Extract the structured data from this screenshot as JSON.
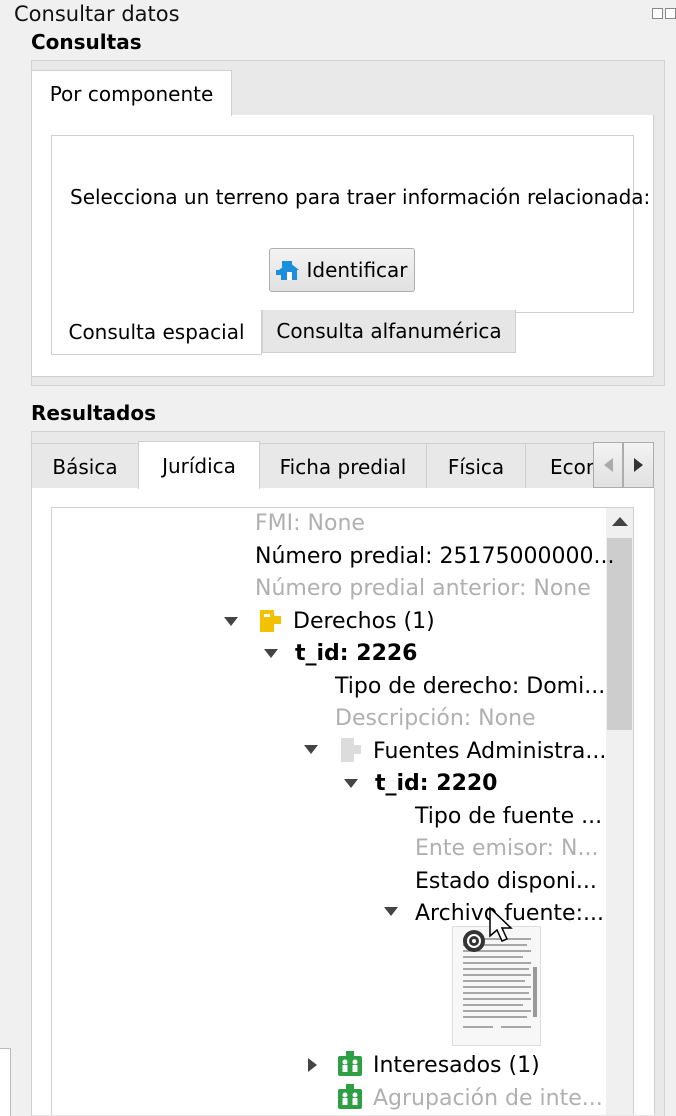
{
  "dock": {
    "title": "Consultar datos"
  },
  "consultas": {
    "title": "Consultas",
    "tab_label": "Por componente",
    "prompt": "Selecciona un terreno para traer información relacionada:",
    "identify_button": "Identificar",
    "subtabs": [
      "Consulta espacial",
      "Consulta alfanumérica"
    ]
  },
  "resultados": {
    "title": "Resultados",
    "tabs": [
      "Básica",
      "Jurídica",
      "Ficha predial",
      "Física",
      "Econ"
    ],
    "active_tab": "Jurídica"
  },
  "tree": {
    "fmi": "FMI: None",
    "numero_predial": "Número predial: 25175000000...",
    "numero_predial_anterior": "Número predial anterior: None",
    "derechos": "Derechos (1)",
    "derecho_tid": "t_id: 2226",
    "tipo_derecho": "Tipo de derecho: Domi...",
    "descripcion": "Descripción: None",
    "fuentes": "Fuentes Administra...",
    "fuente_tid": "t_id: 2220",
    "tipo_fuente": "Tipo de fuente ...",
    "ente_emisor": "Ente emisor: N...",
    "estado": "Estado disponi...",
    "archivo": "Archivo fuente:...",
    "interesados": "Interesados (1)",
    "agrupacion": "Agrupación de inte..."
  },
  "colors": {
    "accent_blue": "#1c8fdc",
    "folder_yellow": "#f2c200",
    "group_green": "#2ea043"
  }
}
